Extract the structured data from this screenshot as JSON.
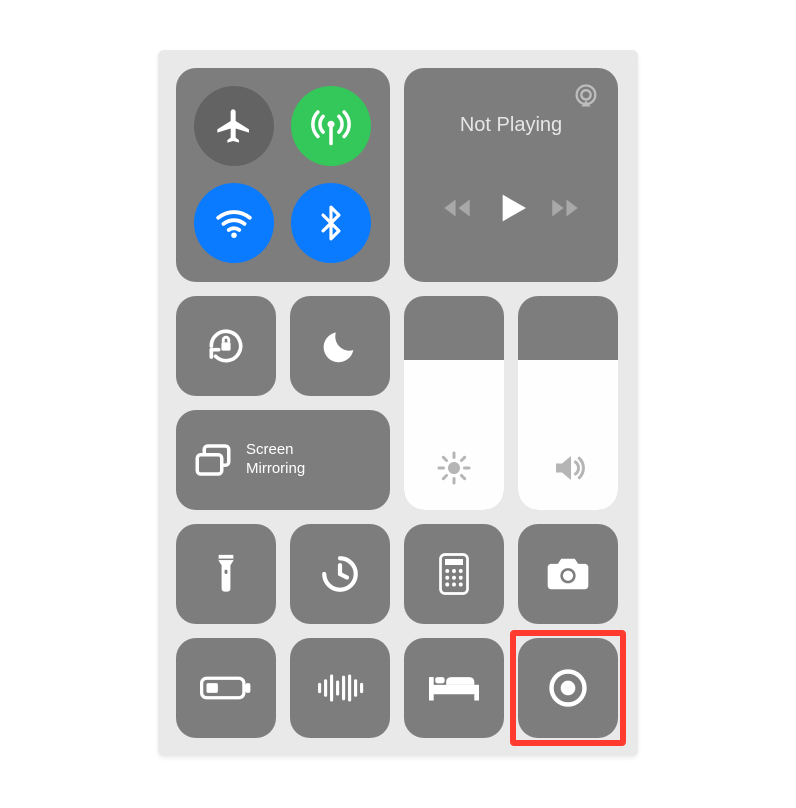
{
  "media": {
    "status": "Not Playing"
  },
  "screen_mirroring": {
    "label": "Screen Mirroring"
  },
  "sliders": {
    "brightness_percent": 70,
    "volume_percent": 70
  },
  "connectivity": {
    "airplane_on": false,
    "cellular_on": true,
    "wifi_on": true,
    "bluetooth_on": true
  },
  "colors": {
    "module_bg": "#7d7d7d",
    "inactive_circle": "#636363",
    "green": "#34c759",
    "blue": "#0a7aff",
    "highlight": "#ff3b2f"
  }
}
